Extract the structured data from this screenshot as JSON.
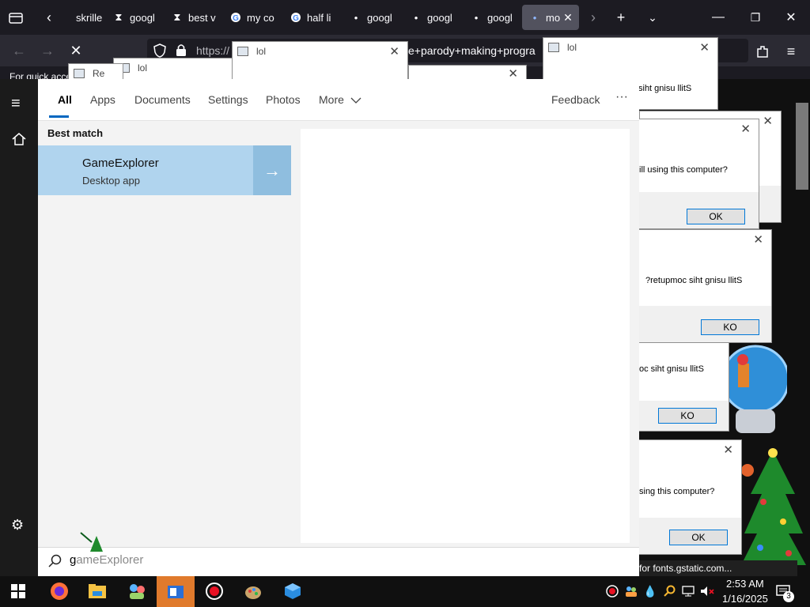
{
  "browser": {
    "tabs": [
      {
        "label": "skrille",
        "icon": "page-icon"
      },
      {
        "label": "googl",
        "icon": "hourglass-icon"
      },
      {
        "label": "best v",
        "icon": "hourglass-icon"
      },
      {
        "label": "my co",
        "icon": "google-icon"
      },
      {
        "label": "half li",
        "icon": "google-icon"
      },
      {
        "label": "googl",
        "icon": "dot-icon"
      },
      {
        "label": "googl",
        "icon": "dot-icon"
      },
      {
        "label": "googl",
        "icon": "dot-icon"
      },
      {
        "label": "mo",
        "icon": "dot-icon"
      }
    ],
    "url_prefix": "https://",
    "url_query": "e+parody+making+progra",
    "quick_access": "For quick acce",
    "partial_label": "Re",
    "status_url": "for fonts.gstatic.com..."
  },
  "dialogs": [
    {
      "title": "lol",
      "message": "",
      "button": ""
    },
    {
      "title": "lol",
      "message": "",
      "button": ""
    },
    {
      "title": "lol",
      "message": "",
      "button": ""
    },
    {
      "title": "lol",
      "message": "siht gnisu llitS",
      "button": ""
    },
    {
      "title": "",
      "message": "ill using this computer?",
      "button": "OK"
    },
    {
      "title": "",
      "message": "?retupmoc siht gnisu llitS",
      "button": "KO"
    },
    {
      "title": "",
      "message": "oc siht gnisu llitS",
      "button": "KO"
    },
    {
      "title": "",
      "message": "sing this computer?",
      "button": "OK"
    }
  ],
  "search": {
    "tabs": [
      "All",
      "Apps",
      "Documents",
      "Settings",
      "Photos",
      "More"
    ],
    "feedback": "Feedback",
    "ellipsis": "···",
    "best_match_label": "Best match",
    "result_name": "GameExplorer",
    "result_type": "Desktop app",
    "query_typed": "g",
    "query_suggestion": "ameExplorer"
  },
  "taskbar": {
    "time": "2:53 AM",
    "date": "1/16/2025",
    "notification_count": "3"
  },
  "colors": {
    "accent": "#0067c0",
    "result_highlight": "#b0d4ee",
    "browser_dark": "#1c1b22"
  }
}
